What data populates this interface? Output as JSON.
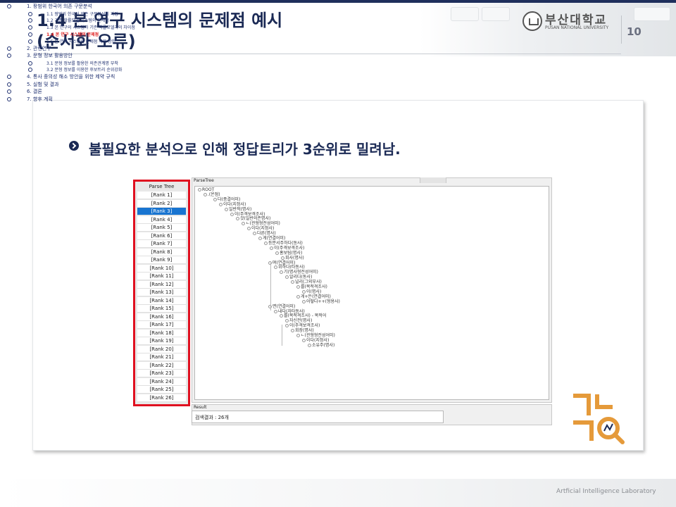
{
  "slide": {
    "title": "1.4 본 연구 시스템의 문제점 예시\n(순서화 오류)",
    "page_number": "10",
    "logo_korean": "부산대학교",
    "logo_english": "PUSAN NATIONAL UNIVERSITY",
    "headline": "불필요한 분석으로 인해 정답트리가 3순위로 밀려남.",
    "footer_lab": "Artficial Intelligence Laboratory",
    "accent_color": "#1b2a55",
    "highlight_color": "#e01020"
  },
  "rank_panel": {
    "header": "Parse Tree",
    "selected_index": 2,
    "items": [
      "[Rank 1]",
      "[Rank 2]",
      "[Rank 3]",
      "[Rank 4]",
      "[Rank 5]",
      "[Rank 6]",
      "[Rank 7]",
      "[Rank 8]",
      "[Rank 9]",
      "[Rank 10]",
      "[Rank 11]",
      "[Rank 12]",
      "[Rank 13]",
      "[Rank 14]",
      "[Rank 15]",
      "[Rank 16]",
      "[Rank 17]",
      "[Rank 18]",
      "[Rank 19]",
      "[Rank 20]",
      "[Rank 21]",
      "[Rank 22]",
      "[Rank 23]",
      "[Rank 24]",
      "[Rank 25]",
      "[Rank 26]"
    ]
  },
  "tree_panel": {
    "label": "ParseTree",
    "nodes": [
      "ROOT",
      ".(온점)",
      "다(종결어미)",
      "이다(지정사)",
      "일반적(명사)",
      "이(주격보격조사)",
      "것(일반의존명사)",
      "ㄴ(관형형전성어미)",
      "이다(지정사)",
      "다른(명사)",
      "게(연결어미)",
      "등분서주하다(동사)",
      "이(주격보격조사)",
      "홍보팀(명사)",
      "회사(명사)",
      "며(연결어미)",
      "위하다(타동사)",
      "기(명사형전성어미)",
      "알리다(동사)",
      "널리(그외부사)",
      "를(목적격조사)",
      "이(명사)",
      "게+든(연결어미)",
      "어떻다++(형용사)",
      "면(연결어미)",
      "내다(자타동사)",
      "를(목적격조사) - 목적어",
      "자신전(명사)",
      "이(주격보격조사)",
      "회장(명사)",
      "ㄴ(관형형전성어미)",
      "이다(지정사)",
      "소유주(명사)"
    ]
  },
  "result_panel": {
    "label": "Result",
    "text": "검색결과 : 26개"
  },
  "toc": [
    {
      "level": 1,
      "text": "1. 팡범위 한국어 의존 구문분석",
      "active": false
    },
    {
      "level": 2,
      "text": "1.1 팡범위 한국어 의존 구문분석의 과정",
      "active": false
    },
    {
      "level": 2,
      "text": "1.2 기존 학률모델 시스템의 문제점",
      "active": false
    },
    {
      "level": 2,
      "text": "1.3 본 연구의 시스템과 기존 학률모델과의 차이점",
      "active": false
    },
    {
      "level": 2,
      "text": "1.4 본 연구 시스템의 문제점",
      "active": true
    },
    {
      "level": 2,
      "text": "1.5 본 연구 시스템의 문제점 극복 방안",
      "active": false
    },
    {
      "level": 1,
      "text": "2. 관련연구",
      "active": false
    },
    {
      "level": 1,
      "text": "3. 문형 정보 활용방안",
      "active": false
    },
    {
      "level": 2,
      "text": "3.1 문형 정보를 활용한 의존관계명 부착",
      "active": false
    },
    {
      "level": 2,
      "text": "3.2 문형 정보를 이용한 후보트리 순위강화",
      "active": false
    },
    {
      "level": 1,
      "text": "4. 통사 중의성 해소 방안을 위한 제약 규칙",
      "active": false
    },
    {
      "level": 1,
      "text": "5. 실험 및 결과",
      "active": false
    },
    {
      "level": 1,
      "text": "6. 결론",
      "active": false
    },
    {
      "level": 1,
      "text": "7. 향후 계획",
      "active": false
    }
  ]
}
